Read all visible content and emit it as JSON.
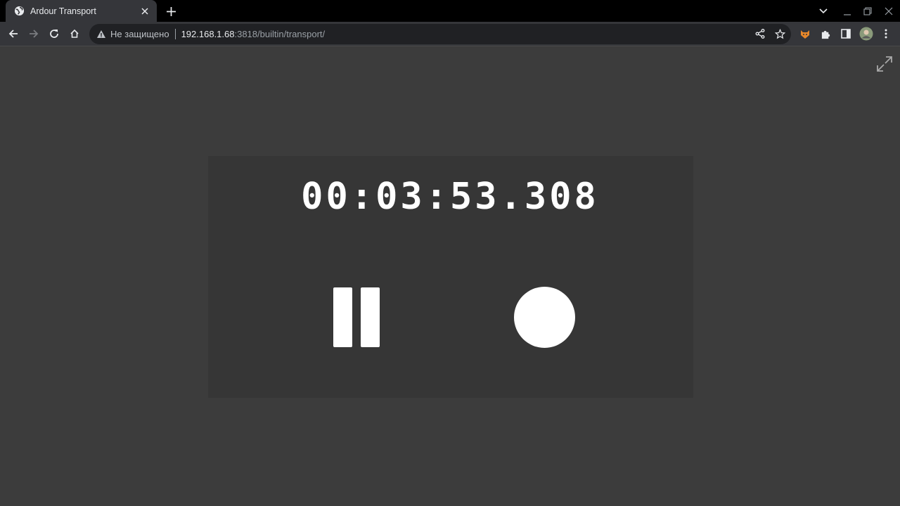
{
  "browser": {
    "tab": {
      "title": "Ardour Transport",
      "favicon": "globe-icon"
    },
    "omnibox": {
      "security_label": "Не защищено",
      "url_host": "192.168.1.68",
      "url_path": ":3818/builtin/transport/"
    }
  },
  "transport": {
    "clock": "00:03:53.308",
    "pause_icon": "pause-icon",
    "record_icon": "record-icon"
  },
  "colors": {
    "page_background": "#3c3c3c",
    "panel_background": "#363636",
    "foreground": "#ffffff"
  }
}
